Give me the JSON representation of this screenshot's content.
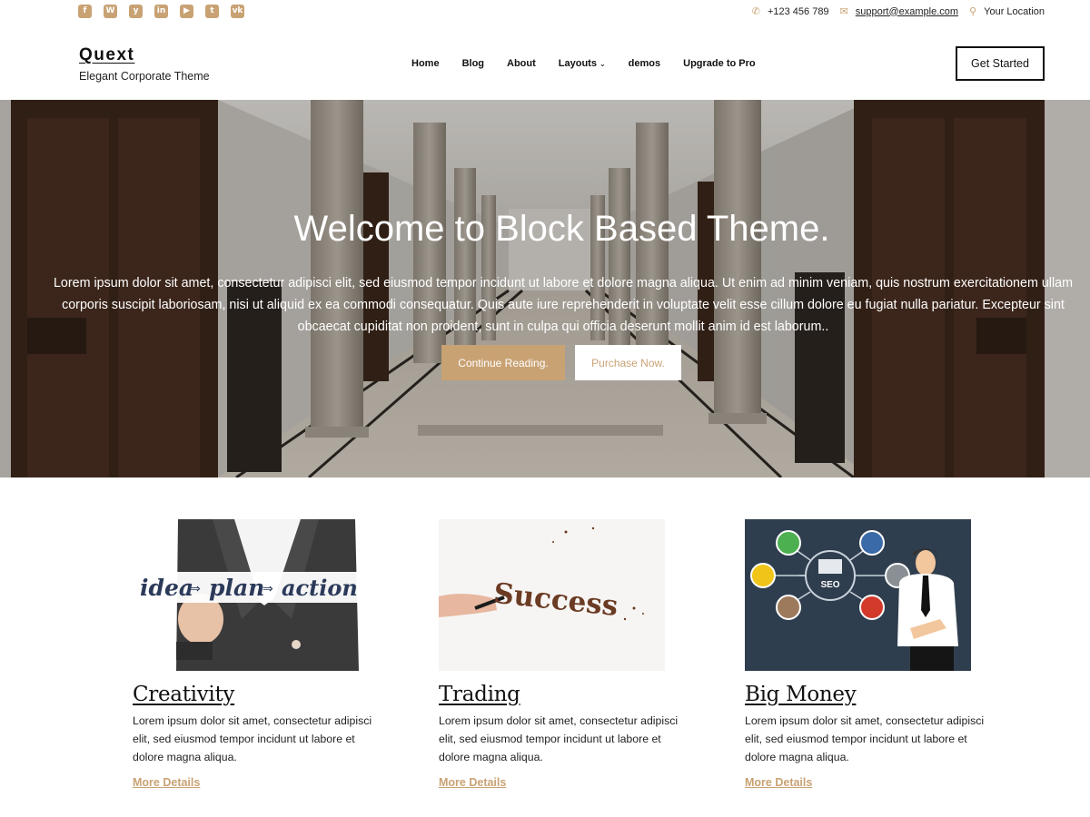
{
  "topbar": {
    "social_icons": [
      "facebook-icon",
      "wordpress-icon",
      "yelp-icon",
      "linkedin-icon",
      "youtube-icon",
      "twitter-icon",
      "vk-icon"
    ],
    "phone": "+123 456 789",
    "email": "support@example.com",
    "location": "Your Location"
  },
  "header": {
    "site_title": "Quext",
    "tagline": "Elegant Corporate Theme",
    "nav": [
      "Home",
      "Blog",
      "About",
      "Layouts",
      "demos",
      "Upgrade to Pro"
    ],
    "cta_label": "Get Started"
  },
  "hero": {
    "title": "Welcome to Block Based Theme.",
    "text_lines": [
      "Lorem ipsum dolor sit amet, consectetur adipisci elit, sed eiusmod tempor incidunt ut labore et dolore magna aliqua. Ut enim ad minim veniam, quis nostrum exercitationem ullam",
      "corporis suscipit laboriosam, nisi ut aliquid ex ea commodi consequatur. Quis aute iure reprehenderit in voluptate velit esse cillum dolore eu fugiat nulla pariatur. Excepteur sint",
      "obcaecat cupiditat non proident, sunt in culpa qui officia deserunt mollit anim id est laborum.."
    ],
    "primary_button": "Continue Reading.",
    "secondary_button": "Purchase Now."
  },
  "cards": [
    {
      "title": "Creativity",
      "image_text": [
        "idea",
        "plan",
        "action"
      ],
      "text_lines": [
        "Lorem ipsum dolor sit amet, consectetur adipisci",
        "elit, sed eiusmod tempor incidunt ut labore et",
        "dolore magna aliqua."
      ],
      "link": "More Details"
    },
    {
      "title": "Trading",
      "image_text": "Success",
      "text_lines": [
        "Lorem ipsum dolor sit amet, consectetur adipisci",
        "elit, sed eiusmod tempor incidunt ut labore et",
        "dolore magna aliqua."
      ],
      "link": "More Details"
    },
    {
      "title": "Big Money",
      "image_text": "SEO",
      "text_lines": [
        "Lorem ipsum dolor sit amet, consectetur adipisci",
        "elit, sed eiusmod tempor incidunt ut labore et",
        "dolore magna aliqua."
      ],
      "link": "More Details"
    }
  ],
  "colors": {
    "accent": "#c9a274",
    "text": "#222222",
    "seo_bg": "#2f3e4e"
  }
}
